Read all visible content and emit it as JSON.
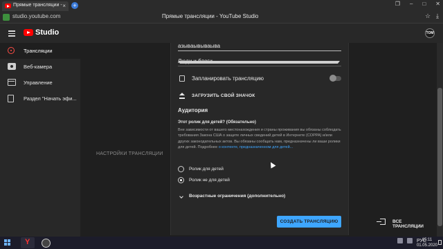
{
  "browser": {
    "tab_title": "Прямые трансляции - ",
    "tab_close": "×",
    "new_tab": "+",
    "url": "studio.youtube.com",
    "page_title": "Прямые трансляции - YouTube Studio",
    "window_buttons": {
      "restore": "❐",
      "minimize": "–",
      "maximize": "□",
      "close": "✕"
    },
    "addr_icons": {
      "bookmark": "☆",
      "download": "⤓"
    }
  },
  "header": {
    "logo_text": "Studio",
    "avatar_text": "TOM"
  },
  "sidebar": {
    "items": [
      {
        "label": "Трансляции",
        "icon": "live-icon",
        "active": true
      },
      {
        "label": "Веб-камера",
        "icon": "camera-icon",
        "active": false
      },
      {
        "label": "Управление",
        "icon": "calendar-icon",
        "active": false
      },
      {
        "label": "Раздел \"Начать эфи...",
        "icon": "mobile-icon",
        "active": false
      }
    ]
  },
  "main": {
    "settings_label": "НАСТРОЙКИ ТРАНСЛЯЦИИ"
  },
  "form": {
    "title_value": "азываывываыва",
    "category_value": "Люди и блоги",
    "schedule_label": "Запланировать трансляцию",
    "upload_label": "ЗАГРУЗИТЬ СВОЙ ЗНАЧОК",
    "audience_heading": "Аудитория",
    "audience_question": "Этот ролик для детей? (Обязательно)",
    "audience_desc": "Вне зависимости от вашего местонахождения и страны проживания вы обязаны соблюдать требования Закона США о защите личных сведений детей в Интернете (COPPA) и/или других законодательных актов. Вы обязаны сообщать нам, предназначены ли ваши ролики для детей. Подробнее ",
    "audience_link": "о контенте, предназначенном для детей...",
    "radio_kids": "Ролик для детей",
    "radio_not_kids": "Ролик не для детей",
    "radio_selected": "not_kids",
    "age_label": "Возрастные ограничения (дополнительно)",
    "create_button": "СОЗДАТЬ ТРАНСЛЯЦИЮ"
  },
  "all_streams": "ВСЕ ТРАНСЛЯЦИИ",
  "taskbar": {
    "lang": "РУС",
    "time": "15:11",
    "date": "01.05.2020"
  },
  "colors": {
    "accent": "#3ea6ff",
    "brand": "#ff0000",
    "background": "#1f1f1f",
    "panel": "#282828"
  }
}
